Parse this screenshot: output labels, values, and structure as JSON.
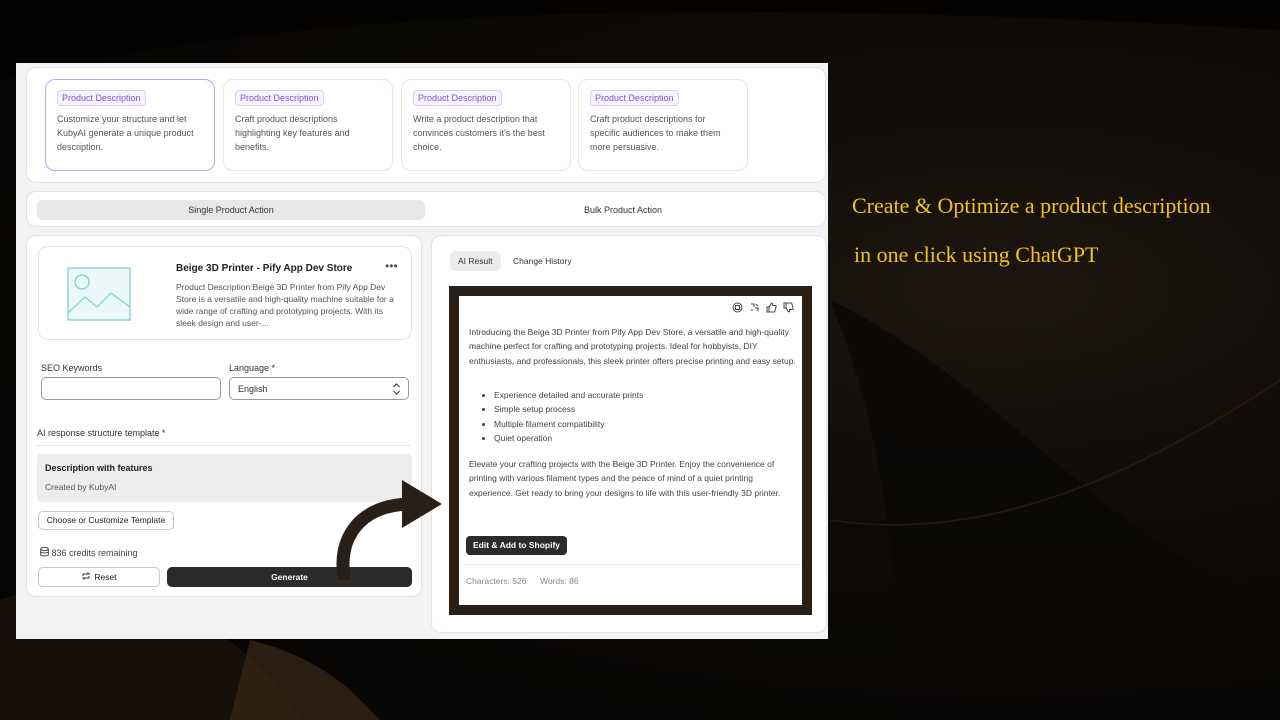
{
  "templates": [
    {
      "badge": "Product Description",
      "desc": "Customize your structure and let KubyAI generate a unique product description.",
      "selected": true
    },
    {
      "badge": "Product Description",
      "desc": "Craft product descriptions highlighting key features and benefits.",
      "selected": false
    },
    {
      "badge": "Product Description",
      "desc": "Write a product description that convinces customers it's the best choice.",
      "selected": false
    },
    {
      "badge": "Product Description",
      "desc": "Craft product descriptions for specific audiences to make them more persuasive.",
      "selected": false
    }
  ],
  "mode_toggle": {
    "single": "Single Product Action",
    "bulk": "Bulk Product Action"
  },
  "product": {
    "title": "Beige 3D Printer - Pify App Dev Store",
    "menu": "•••",
    "description": "Product Description:Beige 3D Printer from Pify App Dev Store is a versatile and high-quality machine suitable for a wide range of crafting and prototyping projects. With its sleek design and user-..."
  },
  "form": {
    "seo_label": "SEO Keywords",
    "seo_value": "",
    "language_label": "Language *",
    "language_value": "English",
    "structure_label": "AI response structure template *",
    "template_title": "Description with features",
    "template_author": "Created by KubyAI",
    "choose_button": "Choose or Customize Template",
    "credits": "836 credits remaining",
    "reset_button": "Reset",
    "generate_button": "Generate"
  },
  "result": {
    "tab_ai": "AI Result",
    "tab_history": "Change History",
    "intro": "Introducing the Beige 3D Printer from Pify App Dev Store, a versatile and high-quality machine perfect for crafting and prototyping projects. Ideal for hobbyists, DIY enthusiasts, and professionals, this sleek printer offers precise printing and easy setup.",
    "features": [
      "Experience detailed and accurate prints",
      "Simple setup process",
      "Multiple filament compatibility",
      "Quiet operation"
    ],
    "outro": "Elevate your crafting projects with the Beige 3D Printer. Enjoy the convenience of printing with various filament types and the peace of mind of a quiet printing experience. Get ready to bring your designs to life with this user-friendly 3D printer.",
    "edit_button": "Edit & Add to Shopify",
    "characters": "Characters: 526",
    "words": "Words: 86",
    "icons": [
      "copy-icon",
      "regenerate-icon",
      "thumbs-up-icon",
      "thumbs-down-icon"
    ]
  },
  "caption": {
    "line1": "Create & Optimize a product description",
    "line2": "in one click using ChatGPT",
    "color": "#f2c21a"
  }
}
